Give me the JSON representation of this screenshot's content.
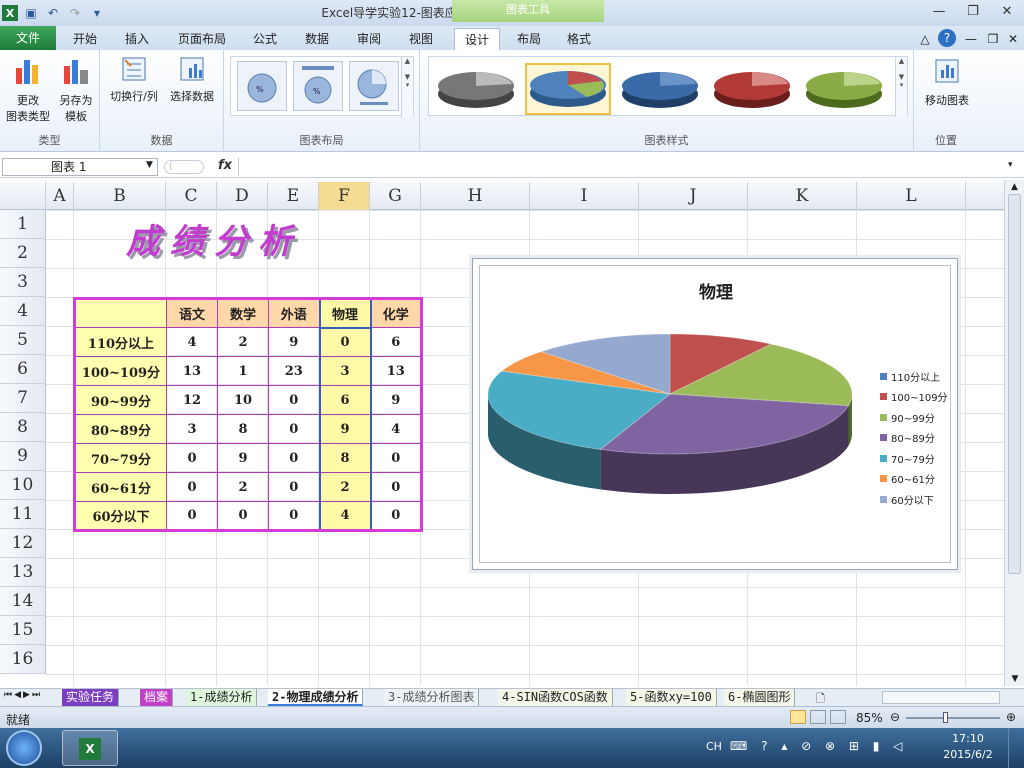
{
  "window": {
    "title": "Excel导学实验12-图表应用1  -  Microsoft Excel",
    "context_tab_group": "图表工具"
  },
  "tabs": [
    "文件",
    "开始",
    "插入",
    "页面布局",
    "公式",
    "数据",
    "审阅",
    "视图",
    "设计",
    "布局",
    "格式"
  ],
  "active_tab": "设计",
  "ribbon": {
    "type_group": {
      "label": "类型",
      "change_type": "更改\n图表类型",
      "save_template": "另存为\n模板"
    },
    "data_group": {
      "label": "数据",
      "switch_row_col": "切换行/列",
      "select_data": "选择数据"
    },
    "layout_group": {
      "label": "图表布局"
    },
    "style_group": {
      "label": "图表样式",
      "selected_index": 1
    },
    "location_group": {
      "label": "位置",
      "move_chart": "移动图表"
    }
  },
  "formula_bar": {
    "name_box": "图表 1",
    "fx": "fx",
    "content": ""
  },
  "columns": [
    "A",
    "B",
    "C",
    "D",
    "E",
    "F",
    "G",
    "H",
    "I",
    "J",
    "K",
    "L"
  ],
  "rows": [
    "1",
    "2",
    "3",
    "4",
    "5",
    "6",
    "7",
    "8",
    "9",
    "10",
    "11",
    "12",
    "13",
    "14",
    "15",
    "16"
  ],
  "wordart": "成绩分析",
  "table": {
    "headers": [
      "",
      "语文",
      "数学",
      "外语",
      "物理",
      "化学"
    ],
    "rows": [
      [
        "110分以上",
        "4",
        "2",
        "9",
        "0",
        "6"
      ],
      [
        "100~109分",
        "13",
        "1",
        "23",
        "3",
        "13"
      ],
      [
        "90~99分",
        "12",
        "10",
        "0",
        "6",
        "9"
      ],
      [
        "80~89分",
        "3",
        "8",
        "0",
        "9",
        "4"
      ],
      [
        "70~79分",
        "0",
        "9",
        "0",
        "8",
        "0"
      ],
      [
        "60~61分",
        "0",
        "2",
        "0",
        "2",
        "0"
      ],
      [
        "60分以下",
        "0",
        "0",
        "0",
        "4",
        "0"
      ]
    ]
  },
  "chart_data": {
    "type": "pie",
    "title": "物理",
    "categories": [
      "110分以上",
      "100~109分",
      "90~99分",
      "80~89分",
      "70~79分",
      "60~61分",
      "60分以下"
    ],
    "values": [
      0,
      3,
      6,
      9,
      8,
      2,
      4
    ],
    "colors": [
      "#4f81bd",
      "#c0504d",
      "#9bbb59",
      "#8064a2",
      "#4bacc6",
      "#f79646",
      "#95a9d0"
    ],
    "legend_position": "right",
    "style": "3d"
  },
  "sheet_tabs": [
    "实验任务",
    "档案",
    "1-成绩分析",
    "2-物理成绩分析",
    "3-成绩分析图表",
    "4-SIN函数COS函数",
    "5-函数xy=100",
    "6-椭圆图形"
  ],
  "active_sheet": "2-物理成绩分析",
  "status": {
    "ready": "就绪",
    "zoom": "85%"
  },
  "taskbar": {
    "lang": "CH",
    "time": "17:10",
    "date": "2015/6/2"
  }
}
